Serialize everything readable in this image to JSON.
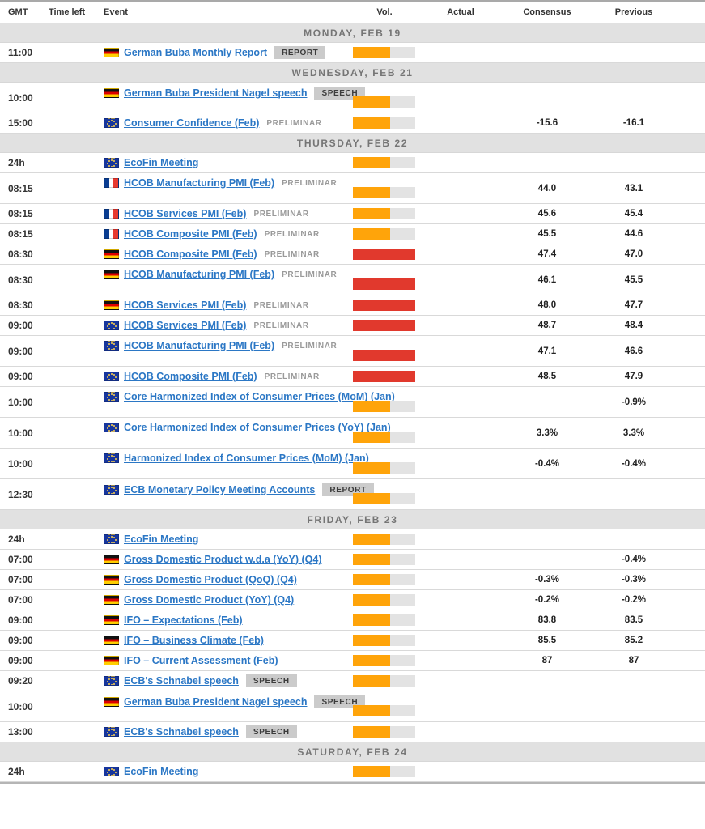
{
  "table": {
    "columns": {
      "gmt": "GMT",
      "time_left": "Time left",
      "event": "Event",
      "vol": "Vol.",
      "actual": "Actual",
      "consensus": "Consensus",
      "previous": "Previous"
    }
  },
  "colors": {
    "orange": "#ffa40a",
    "red": "#e1392d",
    "bar_track": "#e3e3e3",
    "link_blue": "#2b77c5"
  },
  "sections": [
    {
      "header": "MONDAY, FEB 19",
      "rows": [
        {
          "gmt": "11:00",
          "time_left": "",
          "country": "de",
          "event": "German Buba Monthly Report",
          "badge": "REPORT",
          "prelim": "",
          "vol_color": "orange",
          "vol_fill": 60,
          "actual": "",
          "consensus": "",
          "previous": "",
          "tall": false
        }
      ]
    },
    {
      "header": "WEDNESDAY, FEB 21",
      "rows": [
        {
          "gmt": "10:00",
          "time_left": "",
          "country": "de",
          "event": "German Buba President Nagel speech",
          "badge": "SPEECH",
          "prelim": "",
          "vol_color": "orange",
          "vol_fill": 60,
          "actual": "",
          "consensus": "",
          "previous": "",
          "tall": true
        },
        {
          "gmt": "15:00",
          "time_left": "",
          "country": "eu",
          "event": "Consumer Confidence (Feb)",
          "badge": "",
          "prelim": "PRELIMINAR",
          "vol_color": "orange",
          "vol_fill": 60,
          "actual": "",
          "consensus": "-15.6",
          "previous": "-16.1",
          "tall": false
        }
      ]
    },
    {
      "header": "THURSDAY, FEB 22",
      "rows": [
        {
          "gmt": "24h",
          "time_left": "",
          "country": "eu",
          "event": "EcoFin Meeting",
          "badge": "",
          "prelim": "",
          "vol_color": "orange",
          "vol_fill": 60,
          "actual": "",
          "consensus": "",
          "previous": "",
          "tall": false
        },
        {
          "gmt": "08:15",
          "time_left": "",
          "country": "fr",
          "event": "HCOB Manufacturing PMI (Feb)",
          "badge": "",
          "prelim": "PRELIMINAR",
          "vol_color": "orange",
          "vol_fill": 60,
          "actual": "",
          "consensus": "44.0",
          "previous": "43.1",
          "tall": true
        },
        {
          "gmt": "08:15",
          "time_left": "",
          "country": "fr",
          "event": "HCOB Services PMI (Feb)",
          "badge": "",
          "prelim": "PRELIMINAR",
          "vol_color": "orange",
          "vol_fill": 60,
          "actual": "",
          "consensus": "45.6",
          "previous": "45.4",
          "tall": false
        },
        {
          "gmt": "08:15",
          "time_left": "",
          "country": "fr",
          "event": "HCOB Composite PMI (Feb)",
          "badge": "",
          "prelim": "PRELIMINAR",
          "vol_color": "orange",
          "vol_fill": 60,
          "actual": "",
          "consensus": "45.5",
          "previous": "44.6",
          "tall": false
        },
        {
          "gmt": "08:30",
          "time_left": "",
          "country": "de",
          "event": "HCOB Composite PMI (Feb)",
          "badge": "",
          "prelim": "PRELIMINAR",
          "vol_color": "red",
          "vol_fill": 100,
          "actual": "",
          "consensus": "47.4",
          "previous": "47.0",
          "tall": false
        },
        {
          "gmt": "08:30",
          "time_left": "",
          "country": "de",
          "event": "HCOB Manufacturing PMI (Feb)",
          "badge": "",
          "prelim": "PRELIMINAR",
          "vol_color": "red",
          "vol_fill": 100,
          "actual": "",
          "consensus": "46.1",
          "previous": "45.5",
          "tall": true
        },
        {
          "gmt": "08:30",
          "time_left": "",
          "country": "de",
          "event": "HCOB Services PMI (Feb)",
          "badge": "",
          "prelim": "PRELIMINAR",
          "vol_color": "red",
          "vol_fill": 100,
          "actual": "",
          "consensus": "48.0",
          "previous": "47.7",
          "tall": false
        },
        {
          "gmt": "09:00",
          "time_left": "",
          "country": "eu",
          "event": "HCOB Services PMI (Feb)",
          "badge": "",
          "prelim": "PRELIMINAR",
          "vol_color": "red",
          "vol_fill": 100,
          "actual": "",
          "consensus": "48.7",
          "previous": "48.4",
          "tall": false
        },
        {
          "gmt": "09:00",
          "time_left": "",
          "country": "eu",
          "event": "HCOB Manufacturing PMI (Feb)",
          "badge": "",
          "prelim": "PRELIMINAR",
          "vol_color": "red",
          "vol_fill": 100,
          "actual": "",
          "consensus": "47.1",
          "previous": "46.6",
          "tall": true
        },
        {
          "gmt": "09:00",
          "time_left": "",
          "country": "eu",
          "event": "HCOB Composite PMI (Feb)",
          "badge": "",
          "prelim": "PRELIMINAR",
          "vol_color": "red",
          "vol_fill": 100,
          "actual": "",
          "consensus": "48.5",
          "previous": "47.9",
          "tall": false
        },
        {
          "gmt": "10:00",
          "time_left": "",
          "country": "eu",
          "event": "Core Harmonized Index of Consumer Prices (MoM) (Jan)",
          "badge": "",
          "prelim": "",
          "vol_color": "orange",
          "vol_fill": 60,
          "actual": "",
          "consensus": "",
          "previous": "-0.9%",
          "tall": true
        },
        {
          "gmt": "10:00",
          "time_left": "",
          "country": "eu",
          "event": "Core Harmonized Index of Consumer Prices (YoY) (Jan)",
          "badge": "",
          "prelim": "",
          "vol_color": "orange",
          "vol_fill": 60,
          "actual": "",
          "consensus": "3.3%",
          "previous": "3.3%",
          "tall": true
        },
        {
          "gmt": "10:00",
          "time_left": "",
          "country": "eu",
          "event": "Harmonized Index of Consumer Prices (MoM) (Jan)",
          "badge": "",
          "prelim": "",
          "vol_color": "orange",
          "vol_fill": 60,
          "actual": "",
          "consensus": "-0.4%",
          "previous": "-0.4%",
          "tall": true
        },
        {
          "gmt": "12:30",
          "time_left": "",
          "country": "eu",
          "event": "ECB Monetary Policy Meeting Accounts",
          "badge": "REPORT",
          "prelim": "",
          "vol_color": "orange",
          "vol_fill": 60,
          "actual": "",
          "consensus": "",
          "previous": "",
          "tall": true
        }
      ]
    },
    {
      "header": "FRIDAY, FEB 23",
      "rows": [
        {
          "gmt": "24h",
          "time_left": "",
          "country": "eu",
          "event": "EcoFin Meeting",
          "badge": "",
          "prelim": "",
          "vol_color": "orange",
          "vol_fill": 60,
          "actual": "",
          "consensus": "",
          "previous": "",
          "tall": false
        },
        {
          "gmt": "07:00",
          "time_left": "",
          "country": "de",
          "event": "Gross Domestic Product w.d.a (YoY) (Q4)",
          "badge": "",
          "prelim": "",
          "vol_color": "orange",
          "vol_fill": 60,
          "actual": "",
          "consensus": "",
          "previous": "-0.4%",
          "tall": false
        },
        {
          "gmt": "07:00",
          "time_left": "",
          "country": "de",
          "event": "Gross Domestic Product (QoQ) (Q4)",
          "badge": "",
          "prelim": "",
          "vol_color": "orange",
          "vol_fill": 60,
          "actual": "",
          "consensus": "-0.3%",
          "previous": "-0.3%",
          "tall": false
        },
        {
          "gmt": "07:00",
          "time_left": "",
          "country": "de",
          "event": "Gross Domestic Product (YoY) (Q4)",
          "badge": "",
          "prelim": "",
          "vol_color": "orange",
          "vol_fill": 60,
          "actual": "",
          "consensus": "-0.2%",
          "previous": "-0.2%",
          "tall": false
        },
        {
          "gmt": "09:00",
          "time_left": "",
          "country": "de",
          "event": "IFO – Expectations (Feb)",
          "badge": "",
          "prelim": "",
          "vol_color": "orange",
          "vol_fill": 60,
          "actual": "",
          "consensus": "83.8",
          "previous": "83.5",
          "tall": false
        },
        {
          "gmt": "09:00",
          "time_left": "",
          "country": "de",
          "event": "IFO – Business Climate (Feb)",
          "badge": "",
          "prelim": "",
          "vol_color": "orange",
          "vol_fill": 60,
          "actual": "",
          "consensus": "85.5",
          "previous": "85.2",
          "tall": false
        },
        {
          "gmt": "09:00",
          "time_left": "",
          "country": "de",
          "event": "IFO – Current Assessment (Feb)",
          "badge": "",
          "prelim": "",
          "vol_color": "orange",
          "vol_fill": 60,
          "actual": "",
          "consensus": "87",
          "previous": "87",
          "tall": false
        },
        {
          "gmt": "09:20",
          "time_left": "",
          "country": "eu",
          "event": "ECB's Schnabel speech",
          "badge": "SPEECH",
          "prelim": "",
          "vol_color": "orange",
          "vol_fill": 60,
          "actual": "",
          "consensus": "",
          "previous": "",
          "tall": false
        },
        {
          "gmt": "10:00",
          "time_left": "",
          "country": "de",
          "event": "German Buba President Nagel speech",
          "badge": "SPEECH",
          "prelim": "",
          "vol_color": "orange",
          "vol_fill": 60,
          "actual": "",
          "consensus": "",
          "previous": "",
          "tall": true
        },
        {
          "gmt": "13:00",
          "time_left": "",
          "country": "eu",
          "event": "ECB's Schnabel speech",
          "badge": "SPEECH",
          "prelim": "",
          "vol_color": "orange",
          "vol_fill": 60,
          "actual": "",
          "consensus": "",
          "previous": "",
          "tall": false
        }
      ]
    },
    {
      "header": "SATURDAY, FEB 24",
      "rows": [
        {
          "gmt": "24h",
          "time_left": "",
          "country": "eu",
          "event": "EcoFin Meeting",
          "badge": "",
          "prelim": "",
          "vol_color": "orange",
          "vol_fill": 60,
          "actual": "",
          "consensus": "",
          "previous": "",
          "tall": false
        }
      ]
    }
  ]
}
